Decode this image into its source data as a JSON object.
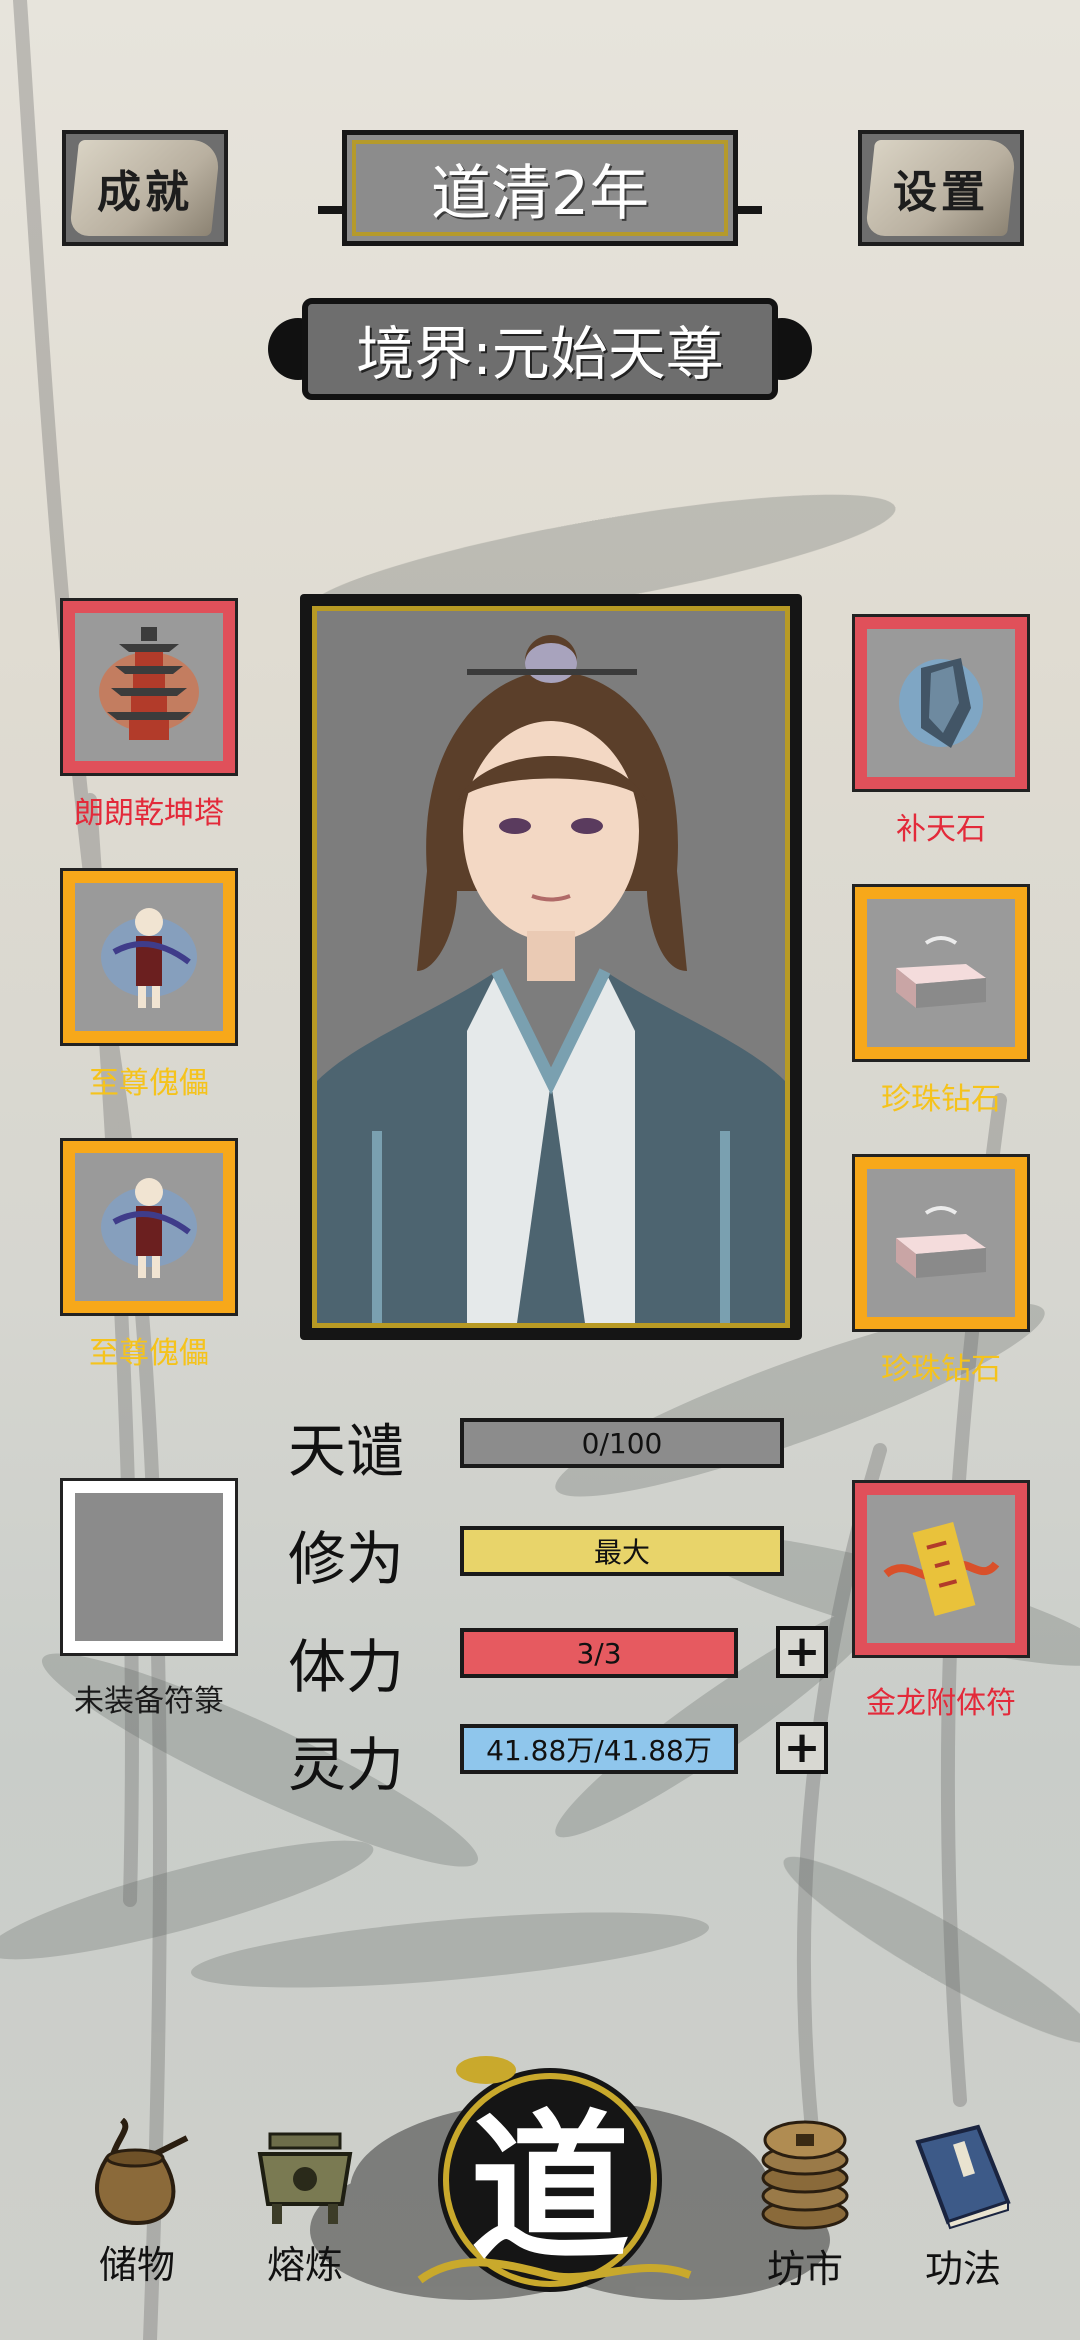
{
  "header": {
    "achievement_label": "成就",
    "year_title": "道清2年",
    "settings_label": "设置",
    "realm": "境界:元始天尊"
  },
  "left_slots": [
    {
      "label": "朗朗乾坤塔",
      "frame": "red",
      "icon": "pagoda-icon"
    },
    {
      "label": "至尊傀儡",
      "frame": "gold",
      "icon": "puppet-icon"
    },
    {
      "label": "至尊傀儡",
      "frame": "gold",
      "icon": "puppet-icon"
    },
    {
      "label": "未装备符箓",
      "frame": "white",
      "icon": "empty-slot"
    }
  ],
  "right_slots": [
    {
      "label": "补天石",
      "frame": "red",
      "icon": "sky-stone-icon"
    },
    {
      "label": "珍珠钻石",
      "frame": "gold",
      "icon": "diamond-icon"
    },
    {
      "label": "珍珠钻石",
      "frame": "gold",
      "icon": "diamond-icon"
    },
    {
      "label": "金龙附体符",
      "frame": "red",
      "icon": "talisman-icon"
    }
  ],
  "stats": [
    {
      "name": "天谴",
      "value": "0/100",
      "fill": 0,
      "color": "#7a7a7a"
    },
    {
      "name": "修为",
      "value": "最大",
      "fill": 1.0,
      "color": "#e8d46a"
    },
    {
      "name": "体力",
      "value": "3/3",
      "fill": 1.0,
      "color": "#e65a60"
    },
    {
      "name": "灵力",
      "value": "41.88万/41.88万",
      "fill": 1.0,
      "color": "#8fc6ec"
    }
  ],
  "plus_symbol": "+",
  "nav": {
    "storage": "储物",
    "smelt": "熔炼",
    "center": "道",
    "market": "坊市",
    "skills": "功法"
  },
  "colors": {
    "red_frame": "#e0505a",
    "gold_frame": "#f7a81a",
    "red_label": "#e32a3a",
    "gold_label": "#f5c31c",
    "plate_border_gold": "#b59a2b"
  }
}
